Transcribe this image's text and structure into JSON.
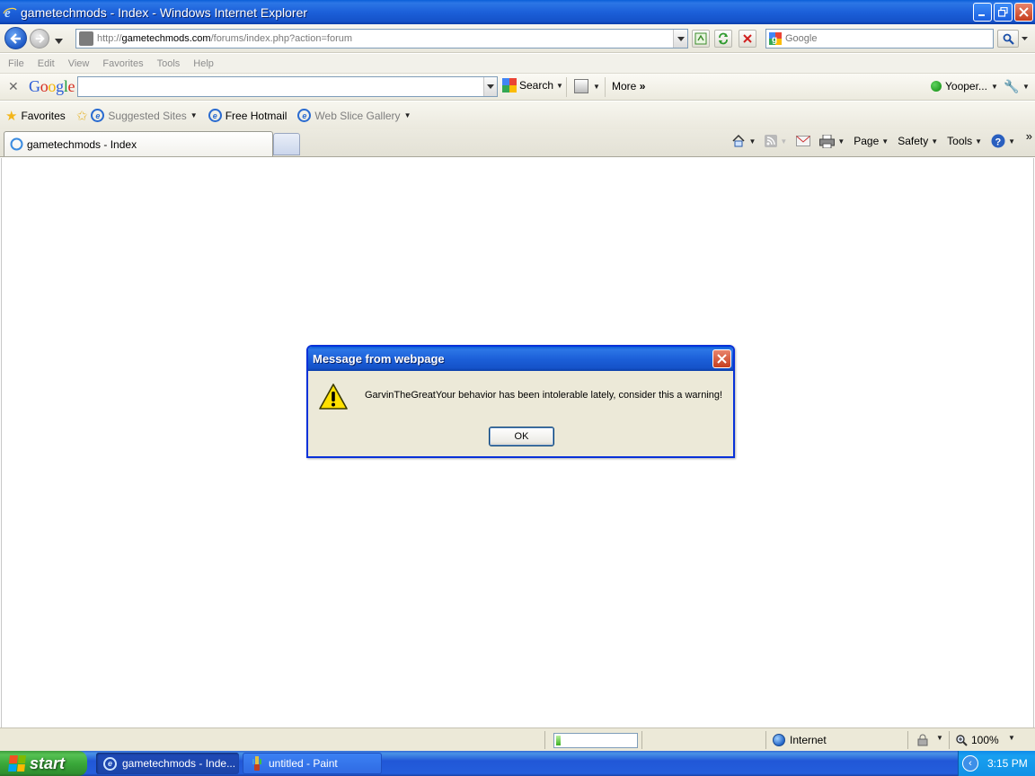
{
  "window": {
    "title": "gametechmods - Index - Windows Internet Explorer"
  },
  "address_bar": {
    "url_prefix": "http://",
    "url_domain": "gametechmods.com",
    "url_path": "/forums/index.php?action=forum"
  },
  "search_box": {
    "placeholder": "Google"
  },
  "menu": {
    "items": [
      "File",
      "Edit",
      "View",
      "Favorites",
      "Tools",
      "Help"
    ]
  },
  "google_toolbar": {
    "logo": "Google",
    "search_label": "Search",
    "more_label": "More",
    "user_label": "Yooper..."
  },
  "favorites_bar": {
    "favorites_label": "Favorites",
    "suggested_sites": "Suggested Sites",
    "free_hotmail": "Free Hotmail",
    "web_slice_gallery": "Web Slice Gallery"
  },
  "tabs": {
    "active_tab_label": "gametechmods - Index"
  },
  "command_bar": {
    "page_label": "Page",
    "safety_label": "Safety",
    "tools_label": "Tools"
  },
  "dialog": {
    "title": "Message from webpage",
    "message": "GarvinTheGreatYour behavior has been intolerable lately, consider this a warning!",
    "ok_label": "OK"
  },
  "status_bar": {
    "progress_fraction": 0.06,
    "zone_label": "Internet",
    "zoom_label": "100%"
  },
  "taskbar": {
    "start_label": "start",
    "tasks": [
      {
        "label": "gametechmods - Inde...",
        "active": true
      },
      {
        "label": "untitled - Paint",
        "active": false
      }
    ],
    "clock": "3:15 PM"
  },
  "colors": {
    "xp_blue": "#0a5fd8",
    "dialog_bg": "#ece9d8",
    "start_green": "#3aa83a"
  },
  "icons": {
    "window_icon": "ie-icon",
    "warning": "warning-icon",
    "back": "back-arrow-icon",
    "forward": "forward-arrow-icon"
  }
}
